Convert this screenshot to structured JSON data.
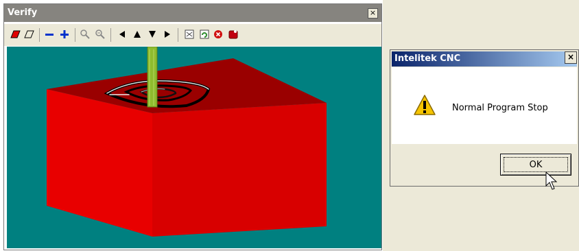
{
  "verify_window": {
    "title": "Verify",
    "close_glyph": "×",
    "toolbar": [
      {
        "name": "solid-view-icon"
      },
      {
        "name": "wireframe-view-icon"
      },
      {
        "name": "zoom-out-minus-icon"
      },
      {
        "name": "zoom-in-plus-icon"
      },
      {
        "name": "zoom-window-icon"
      },
      {
        "name": "zoom-all-icon"
      },
      {
        "name": "rotate-left-icon"
      },
      {
        "name": "rotate-up-icon"
      },
      {
        "name": "rotate-down-icon"
      },
      {
        "name": "rotate-right-icon"
      },
      {
        "name": "view-select-icon"
      },
      {
        "name": "refresh-icon"
      },
      {
        "name": "stop-icon"
      },
      {
        "name": "record-icon"
      }
    ],
    "colors": {
      "viewport_bg": "#008080",
      "block_front": "#e00000",
      "block_top": "#9a0000",
      "block_side": "#c00000",
      "tool": "#8fbc2e"
    }
  },
  "dialog": {
    "title": "Intelitek CNC",
    "close_glyph": "×",
    "message": "Normal Program Stop",
    "ok_label": "OK"
  }
}
